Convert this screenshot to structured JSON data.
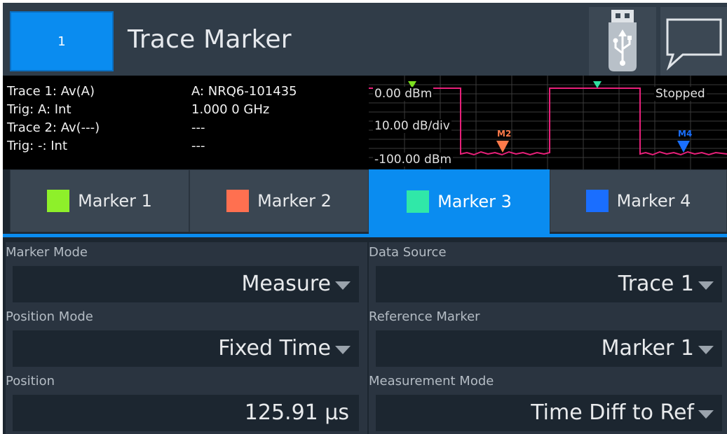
{
  "header": {
    "channel_label": "1",
    "title": "Trace Marker",
    "usb_icon": "usb-icon",
    "message_icon": "message-bubble-icon"
  },
  "info": {
    "trace1": "Trace 1: Av(A)",
    "trig1": "Trig: A: Int",
    "trace2": "Trace 2: Av(---)",
    "trig2": "Trig: -: Int",
    "sensor": "A: NRQ6-101435",
    "freq": "1.000 0 GHz",
    "dash1": "---",
    "dash2": "---"
  },
  "plot": {
    "ref_level": "0.00 dBm",
    "scale": "10.00 dB/div",
    "bottom_level": "-100.00 dBm",
    "status": "Stopped",
    "m2_label": "M2",
    "m4_label": "M4",
    "colors": {
      "trace": "#e8207a",
      "m1": "#7de020",
      "m2": "#ff7a4a",
      "m3": "#30e0a0",
      "m4": "#1a70ff"
    }
  },
  "tabs": [
    {
      "label": "Marker 1",
      "color": "#8ef02a"
    },
    {
      "label": "Marker 2",
      "color": "#ff7050"
    },
    {
      "label": "Marker 3",
      "color": "#30e8a8"
    },
    {
      "label": "Marker 4",
      "color": "#1a6eff"
    }
  ],
  "settings": {
    "marker_mode": {
      "label": "Marker Mode",
      "value": "Measure"
    },
    "data_source": {
      "label": "Data Source",
      "value": "Trace 1"
    },
    "position_mode": {
      "label": "Position Mode",
      "value": "Fixed Time"
    },
    "reference_marker": {
      "label": "Reference Marker",
      "value": "Marker 1"
    },
    "position": {
      "label": "Position",
      "value": "125.91 µs"
    },
    "measurement_mode": {
      "label": "Measurement Mode",
      "value": "Time Diff to Ref"
    }
  }
}
